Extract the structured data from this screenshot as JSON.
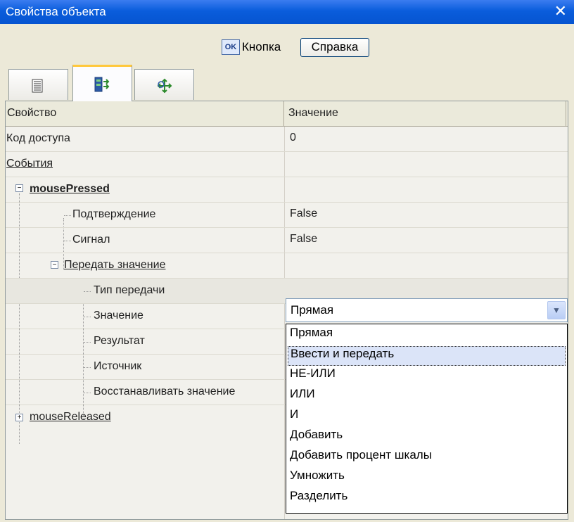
{
  "window": {
    "title": "Свойства объекта",
    "close_glyph": "✕"
  },
  "object": {
    "type_icon_text": "OK",
    "name": "Кнопка",
    "help_button": "Справка"
  },
  "tabs": [
    {
      "icon": "list-icon",
      "active": false
    },
    {
      "icon": "events-icon",
      "active": true
    },
    {
      "icon": "move-icon",
      "active": false
    }
  ],
  "grid": {
    "headers": {
      "property": "Свойство",
      "value": "Значение"
    },
    "rows": {
      "access_code": {
        "label": "Код доступа",
        "value": "0"
      },
      "events": {
        "label": "События"
      },
      "mouse_pressed": {
        "label": "mousePressed"
      },
      "confirmation": {
        "label": "Подтверждение",
        "value": "False"
      },
      "signal": {
        "label": "Сигнал",
        "value": "False"
      },
      "pass_value": {
        "label": "Передать значение"
      },
      "transfer_type": {
        "label": "Тип передачи",
        "value": "Прямая"
      },
      "value": {
        "label": "Значение"
      },
      "result": {
        "label": "Результат"
      },
      "source": {
        "label": "Источник"
      },
      "restore_value": {
        "label": "Восстанавливать значение"
      },
      "mouse_released": {
        "label": "mouseReleased"
      }
    }
  },
  "dropdown": {
    "selected": "Прямая",
    "options": [
      "Прямая",
      "Ввести и передать",
      "НЕ-ИЛИ",
      "ИЛИ",
      "И",
      "Добавить",
      "Добавить процент шкалы",
      "Умножить",
      "Разделить"
    ],
    "hovered_index": 1
  },
  "colors": {
    "titlebar": "#0a5ddc",
    "face": "#ece9d8",
    "active_tab_accent": "#ffc83c"
  }
}
